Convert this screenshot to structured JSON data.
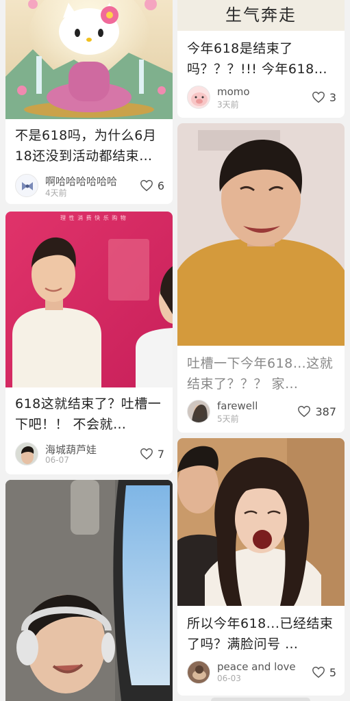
{
  "feed": {
    "cards": [
      {
        "id": "c1",
        "image": {
          "subject": "hello-kitty-meditation-image"
        },
        "title": "不是618吗，为什么6月18还没到活动都结束…",
        "author": "啊哈哈哈哈哈哈",
        "date": "4天前",
        "likes": "6"
      },
      {
        "id": "c2",
        "image": {
          "banner_text": "理 性 消 费 快 乐 购 物"
        },
        "title": "618这就结束了？吐槽一下吧！！ 不会就…",
        "author": "海城葫芦娃",
        "date": "06-07",
        "likes": "7"
      },
      {
        "id": "c3",
        "image": {
          "subject": "crying-girl-headphones-train-window"
        }
      },
      {
        "id": "c4",
        "image": {
          "caption": "生气奔走"
        },
        "title": "今年618是结束了吗？？？!!! 今年618…",
        "author": "momo",
        "date": "3天前",
        "likes": "3"
      },
      {
        "id": "c5",
        "image": {
          "subject": "man-crying-face-meme"
        },
        "title": "吐槽一下今年618…这就结束了？？？ 家…",
        "author": "farewell",
        "date": "5天前",
        "likes": "387"
      },
      {
        "id": "c6",
        "image": {
          "subject": "girl-screaming-meme"
        },
        "title": "所以今年618...已经结束了吗？满脸问号 …",
        "author": "peace and love",
        "date": "06-03",
        "likes": "5"
      }
    ]
  },
  "colors": {
    "background": "#f2f2f2",
    "card": "#ffffff",
    "title": "#222222",
    "subtle": "#aaaaaa",
    "banner_pink": "#e23a6a"
  },
  "icons": {
    "like": "heart-outline-icon"
  }
}
